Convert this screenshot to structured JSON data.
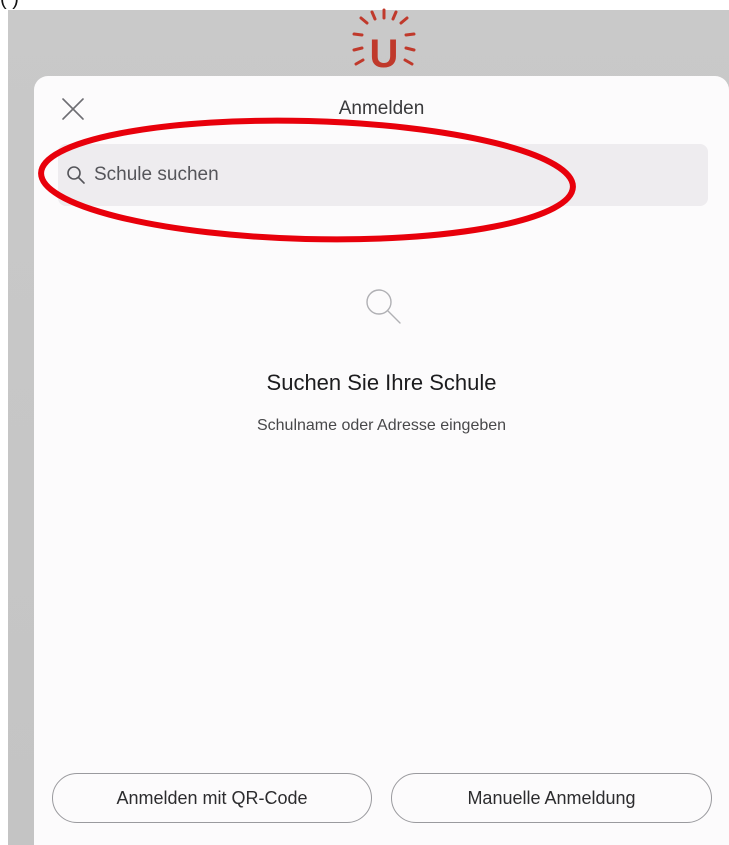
{
  "top_caption": "(                )",
  "logo": {
    "letter": "U",
    "color": "#c0392b"
  },
  "modal": {
    "title": "Anmelden",
    "close_icon": "close-icon"
  },
  "search": {
    "placeholder": "Schule suchen",
    "value": "",
    "icon": "search-icon"
  },
  "annotation": {
    "shape": "ellipse",
    "color": "#e8000b"
  },
  "empty_state": {
    "icon": "search-icon",
    "title": "Suchen Sie Ihre Schule",
    "subtitle": "Schulname oder Adresse eingeben"
  },
  "actions": {
    "qr_label": "Anmelden mit QR-Code",
    "manual_label": "Manuelle Anmeldung"
  }
}
